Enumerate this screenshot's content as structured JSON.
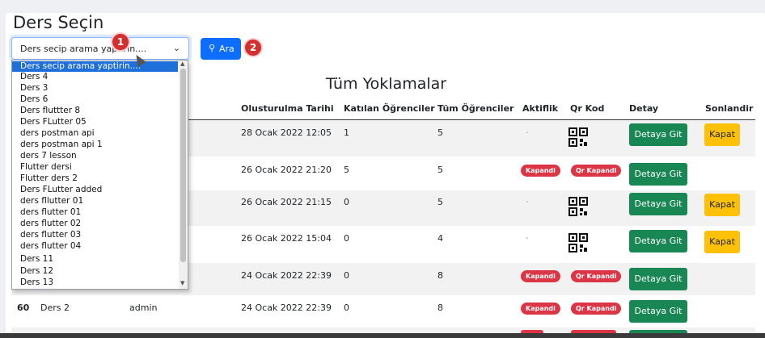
{
  "page": {
    "title": "Ders Seçin",
    "table_title": "Tüm Yoklamalar"
  },
  "search": {
    "selected": "Ders secip arama yaptirin....",
    "button_label": "Ara",
    "button_icon": "search-icon"
  },
  "callouts": [
    "1",
    "2"
  ],
  "dropdown": {
    "options": [
      "Ders secip arama yaptirin....",
      "Ders 4",
      "Ders 3",
      "Ders 6",
      "Ders fluttter 8",
      "Ders FLutter 05",
      "ders postman api",
      "ders postman api 1",
      "ders 7 lesson",
      "Flutter dersi",
      "Flutter ders 2",
      "Ders FLutter added",
      "ders fllutter 01",
      "ders flutter 01",
      "ders flutter 02",
      "ders flutter 03",
      "ders flutter 04",
      "Ders 11",
      "Ders 12",
      "Ders 13"
    ]
  },
  "table": {
    "columns": [
      "Olusturulma Tarihi",
      "Katılan Öğrenciler",
      "Tüm Öğrenciler",
      "Aktiflik",
      "Qr Kod",
      "Detay",
      "Sonlandir"
    ],
    "rows": [
      {
        "id": "",
        "ders": "",
        "user": "",
        "date": "28 Ocak 2022 12:05",
        "katilan": "1",
        "tum": "5",
        "aktif": "",
        "qr": "qr",
        "detay": "Detaya Git",
        "sonlandir": "Kapat"
      },
      {
        "id": "",
        "ders": "",
        "user": "",
        "date": "26 Ocak 2022 21:20",
        "katilan": "5",
        "tum": "5",
        "aktif": "Kapandi",
        "qr": "Qr Kapandi",
        "detay": "Detaya Git",
        "sonlandir": ""
      },
      {
        "id": "",
        "ders": "",
        "user": "",
        "date": "26 Ocak 2022 21:15",
        "katilan": "0",
        "tum": "5",
        "aktif": "",
        "qr": "qr",
        "detay": "Detaya Git",
        "sonlandir": "Kapat"
      },
      {
        "id": "",
        "ders": "",
        "user": "",
        "date": "26 Ocak 2022 15:04",
        "katilan": "0",
        "tum": "4",
        "aktif": "",
        "qr": "qr",
        "detay": "Detaya Git",
        "sonlandir": "Kapat"
      },
      {
        "id": "",
        "ders": "",
        "user": "",
        "date": "24 Ocak 2022 22:39",
        "katilan": "0",
        "tum": "8",
        "aktif": "Kapandi",
        "qr": "Qr Kapandi",
        "detay": "Detaya Git",
        "sonlandir": ""
      },
      {
        "id": "60",
        "ders": "Ders 2",
        "user": "admin",
        "date": "24 Ocak 2022 22:39",
        "katilan": "0",
        "tum": "8",
        "aktif": "Kapandi",
        "qr": "Qr Kapandi",
        "detay": "Detaya Git",
        "sonlandir": ""
      }
    ]
  },
  "colors": {
    "primary": "#0d6efd",
    "success": "#198754",
    "warning": "#ffc107",
    "danger": "#dc3545",
    "callout": "#d32f2f"
  }
}
